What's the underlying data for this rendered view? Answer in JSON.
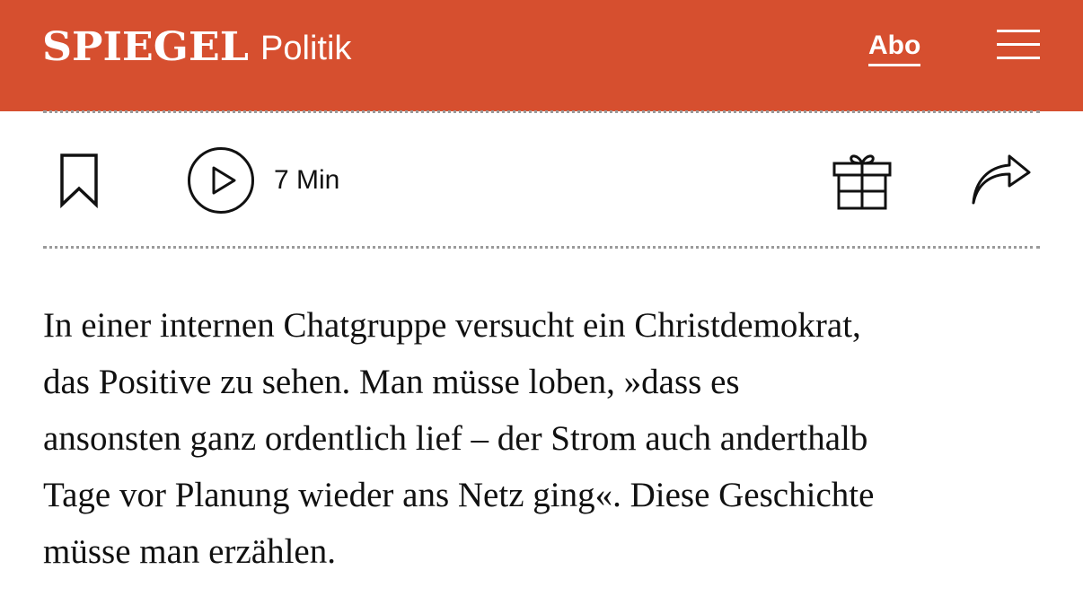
{
  "header": {
    "logo": "SPIEGEL",
    "section": "Politik",
    "abo_label": "Abo",
    "menu_icon": "hamburger-menu-icon",
    "background_color": "#d64f2f"
  },
  "toolbar": {
    "bookmark_icon": "bookmark-icon",
    "play_icon": "play-circle-icon",
    "duration": "7 Min",
    "gift_icon": "gift-icon",
    "share_icon": "share-arrow-icon"
  },
  "article": {
    "lines": [
      "In einer internen Chatgruppe versucht ein Christdemokrat,",
      "das Positive zu sehen. Man müsse loben, »dass es",
      "ansonsten ganz ordentlich lief – der Strom auch anderthalb",
      "Tage vor Planung wieder ans Netz ging«. Diese Geschichte",
      "müsse man erzählen."
    ]
  }
}
